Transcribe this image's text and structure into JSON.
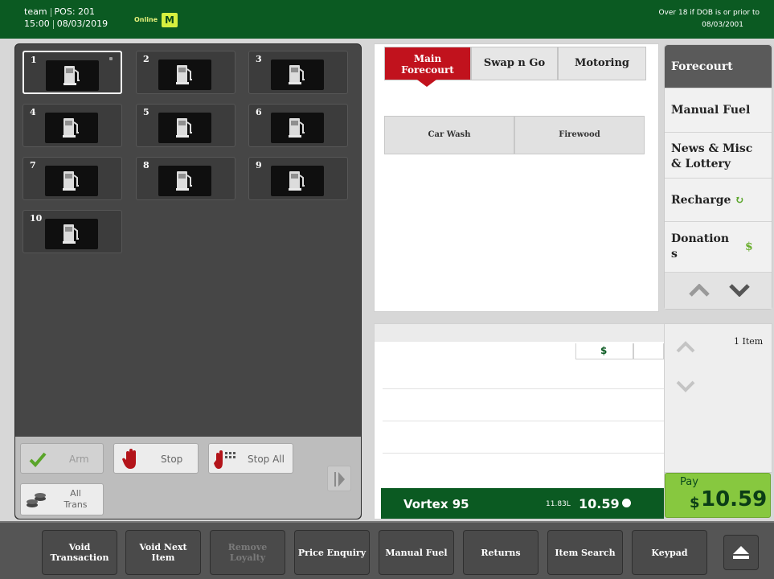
{
  "header": {
    "user": "team",
    "pos": "POS: 201",
    "time": "15:00",
    "date": "08/03/2019",
    "status": "Online",
    "mode_badge": "M",
    "age_notice_line1": "Over 18 if DOB is or prior to",
    "age_notice_line2": "08/03/2001"
  },
  "pumps": [
    {
      "number": "1",
      "selected": true
    },
    {
      "number": "2"
    },
    {
      "number": "3"
    },
    {
      "number": "4"
    },
    {
      "number": "5"
    },
    {
      "number": "6"
    },
    {
      "number": "7"
    },
    {
      "number": "8"
    },
    {
      "number": "9"
    },
    {
      "number": "10"
    }
  ],
  "pump_controls": {
    "arm": "Arm",
    "stop": "Stop",
    "stop_all": "Stop All",
    "all_trans_line1": "All",
    "all_trans_line2": "Trans"
  },
  "tabs": {
    "main_forecourt_line1": "Main",
    "main_forecourt_line2": "Forecourt",
    "swap_n_go": "Swap n Go",
    "motoring": "Motoring"
  },
  "quick_items": [
    "Car Wash",
    "Firewood"
  ],
  "right_nav": {
    "forecourt": "Forecourt",
    "manual_fuel": "Manual Fuel",
    "news_line1": "News & Misc",
    "news_line2": "& Lottery",
    "recharge": "Recharge",
    "donations_line1": "Donation",
    "donations_line2": "s",
    "donations_symbol": "$"
  },
  "receipt": {
    "currency_header": "$",
    "item_count": "1 Item",
    "product": "Vortex 95",
    "volume": "11.83L",
    "amount": "10.59"
  },
  "pay": {
    "label": "Pay",
    "currency": "$",
    "amount": "10.59"
  },
  "bottom_bar": {
    "void_transaction_1": "Void",
    "void_transaction_2": "Transaction",
    "void_next_item_1": "Void Next",
    "void_next_item_2": "Item",
    "remove_loyalty_1": "Remove",
    "remove_loyalty_2": "Loyalty",
    "price_enquiry": "Price Enquiry",
    "manual_fuel": "Manual Fuel",
    "returns": "Returns",
    "item_search": "Item Search",
    "keypad": "Keypad"
  },
  "colors": {
    "header_green": "#0b5a22",
    "active_tab_red": "#c1121d",
    "pay_green": "#87c83f"
  }
}
